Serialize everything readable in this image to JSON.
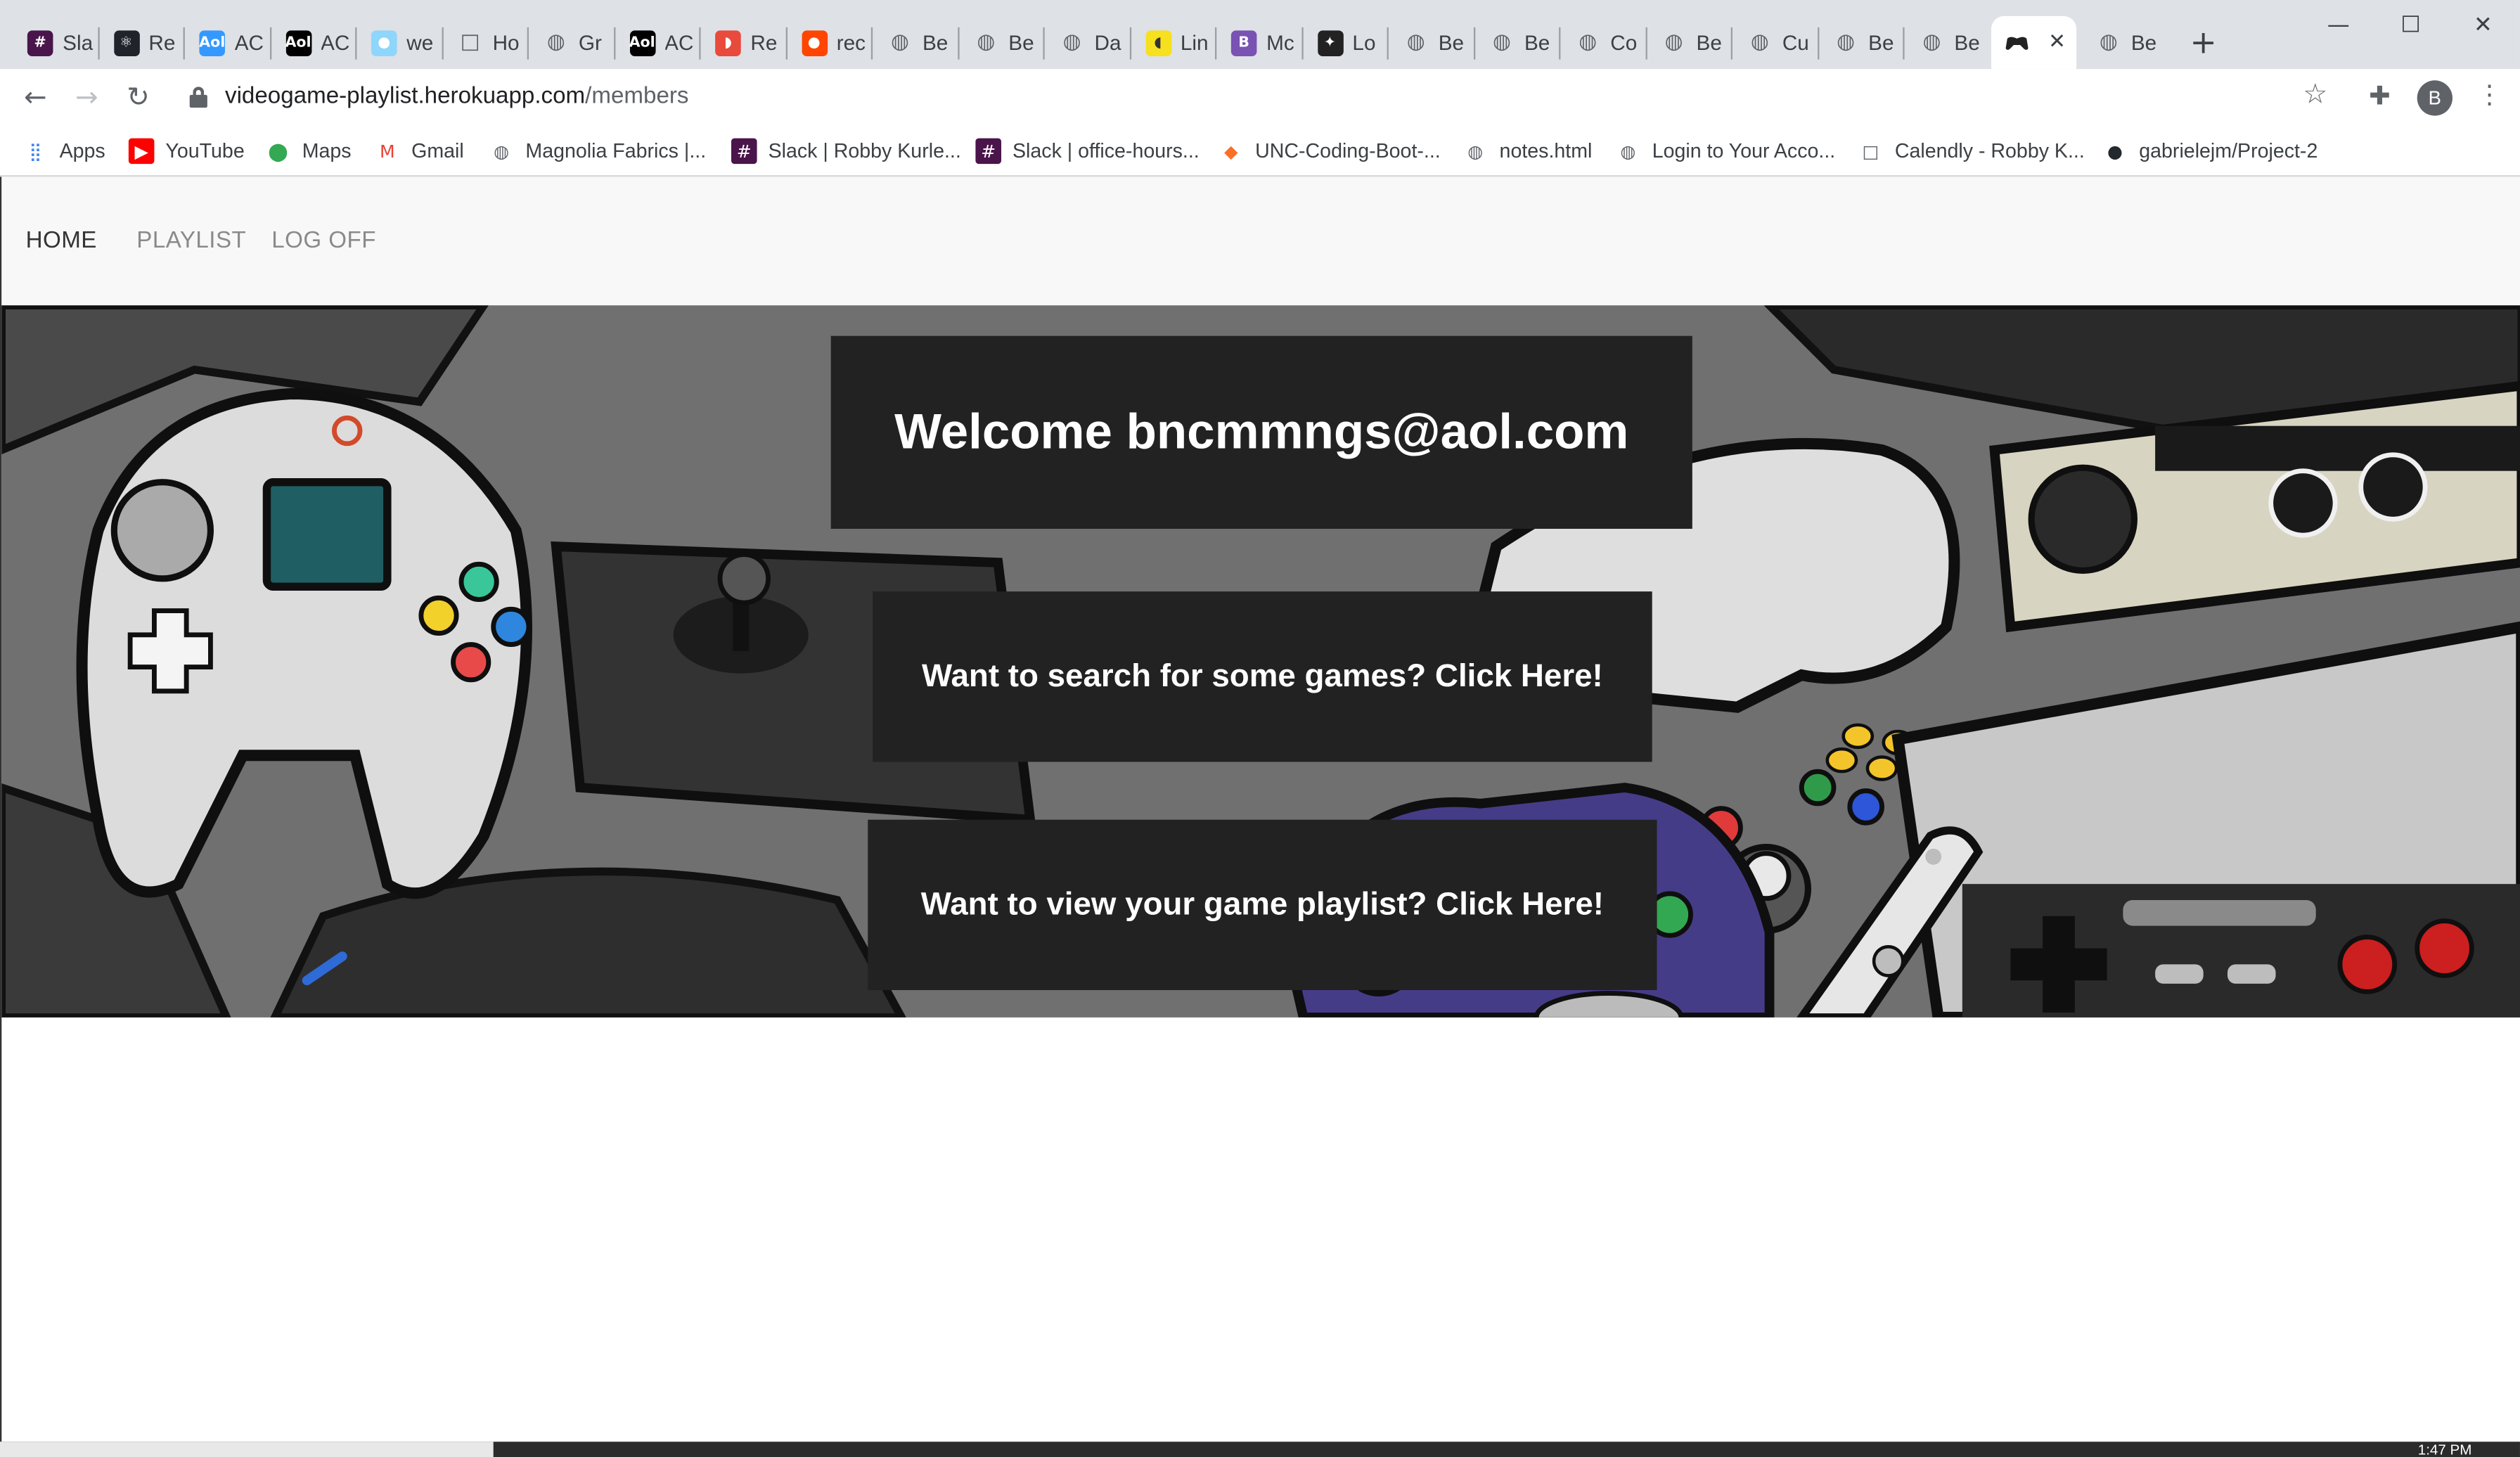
{
  "browser": {
    "tabs": [
      {
        "title": "Sla",
        "icon": "slack-icon",
        "color": "#4a154b",
        "glyph": "#"
      },
      {
        "title": "Re",
        "icon": "react-icon",
        "color": "#20232a",
        "glyph": "⚛"
      },
      {
        "title": "AC",
        "icon": "aol-icon",
        "color": "#3399ff",
        "glyph": "Aol"
      },
      {
        "title": "AC",
        "icon": "aol-icon",
        "color": "#000000",
        "glyph": "Aol"
      },
      {
        "title": "we",
        "icon": "webpack-icon",
        "color": "#8ed6fb",
        "glyph": "●"
      },
      {
        "title": "Ho",
        "icon": "generic-page-icon",
        "color": "#5f6368",
        "glyph": "□"
      },
      {
        "title": "Gr",
        "icon": "globe-icon",
        "color": "#5f6368",
        "glyph": "◍"
      },
      {
        "title": "AC",
        "icon": "aol-icon",
        "color": "#000000",
        "glyph": "Aol"
      },
      {
        "title": "Re",
        "icon": "app-icon",
        "color": "#e84a3c",
        "glyph": "◗"
      },
      {
        "title": "rec",
        "icon": "reddit-icon",
        "color": "#ff4500",
        "glyph": "●"
      },
      {
        "title": "Be",
        "icon": "globe-icon",
        "color": "#5f6368",
        "glyph": "◍"
      },
      {
        "title": "Be",
        "icon": "globe-icon",
        "color": "#5f6368",
        "glyph": "◍"
      },
      {
        "title": "Da",
        "icon": "globe-icon",
        "color": "#5f6368",
        "glyph": "◍"
      },
      {
        "title": "Lin",
        "icon": "linter-icon",
        "color": "#f7e01d",
        "glyph": "◖"
      },
      {
        "title": "Mc",
        "icon": "bootstrap-icon",
        "color": "#7952b3",
        "glyph": "B"
      },
      {
        "title": "Lo",
        "icon": "controller-icon",
        "color": "#222222",
        "glyph": "✦"
      },
      {
        "title": "Be",
        "icon": "globe-icon",
        "color": "#5f6368",
        "glyph": "◍"
      },
      {
        "title": "Be",
        "icon": "globe-icon",
        "color": "#5f6368",
        "glyph": "◍"
      },
      {
        "title": "Co",
        "icon": "globe-icon",
        "color": "#5f6368",
        "glyph": "◍"
      },
      {
        "title": "Be",
        "icon": "globe-icon",
        "color": "#5f6368",
        "glyph": "◍"
      },
      {
        "title": "Cu",
        "icon": "globe-icon",
        "color": "#5f6368",
        "glyph": "◍"
      },
      {
        "title": "Be",
        "icon": "globe-icon",
        "color": "#5f6368",
        "glyph": "◍"
      },
      {
        "title": "Be",
        "icon": "globe-icon",
        "color": "#5f6368",
        "glyph": "◍"
      }
    ],
    "active_tab": {
      "icon": "controller-icon",
      "close": "✕"
    },
    "after_tab": {
      "title": "Be",
      "icon": "globe-icon"
    },
    "new_tab": "+",
    "url_host": "videogame-playlist.herokuapp.com",
    "url_path": "/members",
    "profile_initial": "B",
    "bookmarks": [
      {
        "label": "Apps",
        "icon": "apps-grid-icon"
      },
      {
        "label": "YouTube",
        "icon": "youtube-icon"
      },
      {
        "label": "Maps",
        "icon": "maps-pin-icon"
      },
      {
        "label": "Gmail",
        "icon": "gmail-icon"
      },
      {
        "label": "Magnolia Fabrics |...",
        "icon": "globe-icon"
      },
      {
        "label": "Slack | Robby Kurle...",
        "icon": "slack-icon"
      },
      {
        "label": "Slack | office-hours...",
        "icon": "slack-icon"
      },
      {
        "label": "UNC-Coding-Boot-...",
        "icon": "gitlab-icon"
      },
      {
        "label": "notes.html",
        "icon": "globe-icon"
      },
      {
        "label": "Login to Your Acco...",
        "icon": "globe-icon"
      },
      {
        "label": "Calendly - Robby K...",
        "icon": "calendly-icon"
      },
      {
        "label": "gabrielejm/Project-2",
        "icon": "github-icon"
      }
    ]
  },
  "site": {
    "nav": [
      {
        "label": "HOME",
        "active": true
      },
      {
        "label": "PLAYLIST",
        "active": false
      },
      {
        "label": "LOG OFF",
        "active": false
      }
    ],
    "welcome": "Welcome bncmmngs@aol.com",
    "search_cta": "Want to search for some games? Click Here!",
    "playlist_cta": "Want to view your game playlist? Click Here!"
  },
  "taskbar": {
    "clock": "1:47 PM"
  }
}
